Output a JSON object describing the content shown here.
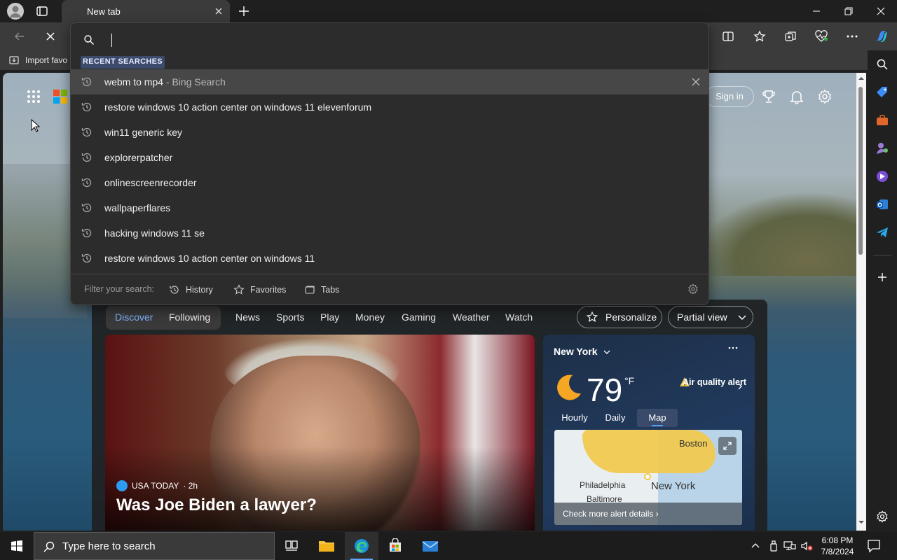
{
  "tab": {
    "title": "New tab"
  },
  "favorites_bar": {
    "import_label": "Import favo"
  },
  "omnibox": {
    "recent_label": "RECENT SEARCHES",
    "suggestions": [
      {
        "text": "webm to mp4",
        "suffix": " - Bing Search"
      },
      {
        "text": "restore windows 10 action center on windows 11 elevenforum",
        "suffix": ""
      },
      {
        "text": "win11 generic key",
        "suffix": ""
      },
      {
        "text": "explorerpatcher",
        "suffix": ""
      },
      {
        "text": "onlinescreenrecorder",
        "suffix": ""
      },
      {
        "text": "wallpaperflares",
        "suffix": ""
      },
      {
        "text": "hacking windows 11 se",
        "suffix": ""
      },
      {
        "text": "restore windows 10 action center on windows 11",
        "suffix": ""
      }
    ],
    "filter_label": "Filter your search:",
    "filters": {
      "history": "History",
      "favorites": "Favorites",
      "tabs": "Tabs"
    }
  },
  "page_header": {
    "signin": "Sign in"
  },
  "feed_nav": {
    "items": [
      "Discover",
      "Following",
      "News",
      "Sports",
      "Play",
      "Money",
      "Gaming",
      "Weather",
      "Watch"
    ],
    "personalize": "Personalize",
    "partial_view": "Partial view"
  },
  "hero": {
    "source": "USA TODAY",
    "age": " · 2h",
    "headline": "Was Joe Biden a lawyer?"
  },
  "weather": {
    "city": "New York",
    "temp": "79",
    "unit": "°F",
    "alert": "Air quality alert",
    "tabs": [
      "Hourly",
      "Daily",
      "Map"
    ],
    "map_labels": {
      "boston": "Boston",
      "philadelphia": "Philadelphia",
      "baltimore": "Baltimore",
      "new_york": "New York"
    },
    "more_alerts": "Check more alert details"
  },
  "taskbar": {
    "search_placeholder": "Type here to search",
    "time": "6:08 PM",
    "date": "7/8/2024"
  },
  "colors": {
    "accent": "#2f6fd0",
    "omni_bg": "#2c2c2c",
    "weather_alert": "#f2c94c"
  }
}
